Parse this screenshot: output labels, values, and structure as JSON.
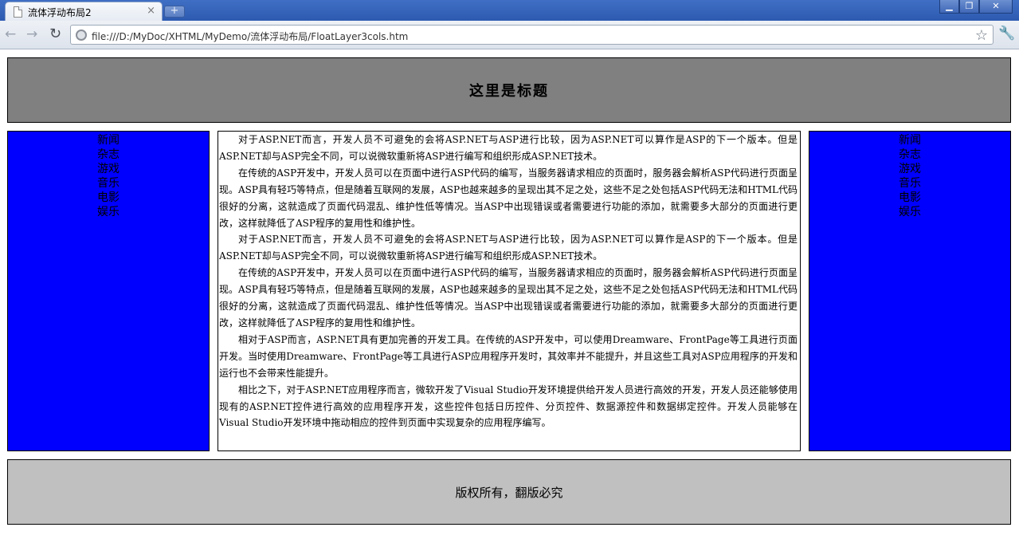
{
  "browser": {
    "tab_title": "流体浮动布局2",
    "tab_close": "×",
    "new_tab": "+",
    "url": "file:///D:/MyDoc/XHTML/MyDemo/流体浮动布局/FloatLayer3cols.htm"
  },
  "header": {
    "title": "这里是标题"
  },
  "left_nav": {
    "items": [
      "新闻",
      "杂志",
      "游戏",
      "音乐",
      "电影",
      "娱乐"
    ]
  },
  "right_nav": {
    "items": [
      "新闻",
      "杂志",
      "游戏",
      "音乐",
      "电影",
      "娱乐"
    ]
  },
  "main": {
    "paragraphs": [
      "对于ASP.NET而言，开发人员不可避免的会将ASP.NET与ASP进行比较，因为ASP.NET可以算作是ASP的下一个版本。但是ASP.NET却与ASP完全不同，可以说微软重新将ASP进行编写和组织形成ASP.NET技术。",
      "在传统的ASP开发中，开发人员可以在页面中进行ASP代码的编写，当服务器请求相应的页面时，服务器会解析ASP代码进行页面呈现。ASP具有轻巧等特点，但是随着互联网的发展，ASP也越来越多的呈现出其不足之处，这些不足之处包括ASP代码无法和HTML代码很好的分离，这就造成了页面代码混乱、维护性低等情况。当ASP中出现错误或者需要进行功能的添加，就需要多大部分的页面进行更改，这样就降低了ASP程序的复用性和维护性。",
      "对于ASP.NET而言，开发人员不可避免的会将ASP.NET与ASP进行比较，因为ASP.NET可以算作是ASP的下一个版本。但是ASP.NET却与ASP完全不同，可以说微软重新将ASP进行编写和组织形成ASP.NET技术。",
      "在传统的ASP开发中，开发人员可以在页面中进行ASP代码的编写，当服务器请求相应的页面时，服务器会解析ASP代码进行页面呈现。ASP具有轻巧等特点，但是随着互联网的发展，ASP也越来越多的呈现出其不足之处，这些不足之处包括ASP代码无法和HTML代码很好的分离，这就造成了页面代码混乱、维护性低等情况。当ASP中出现错误或者需要进行功能的添加，就需要多大部分的页面进行更改，这样就降低了ASP程序的复用性和维护性。",
      "相对于ASP而言，ASP.NET具有更加完善的开发工具。在传统的ASP开发中，可以使用Dreamware、FrontPage等工具进行页面开发。当时使用Dreamware、FrontPage等工具进行ASP应用程序开发时，其效率并不能提升，并且这些工具对ASP应用程序的开发和运行也不会带来性能提升。",
      "相比之下，对于ASP.NET应用程序而言，微软开发了Visual Studio开发环境提供给开发人员进行高效的开发，开发人员还能够使用现有的ASP.NET控件进行高效的应用程序开发，这些控件包括日历控件、分页控件、数据源控件和数据绑定控件。开发人员能够在Visual Studio开发环境中拖动相应的控件到页面中实现复杂的应用程序编写。"
    ]
  },
  "footer": {
    "text": "版权所有，翻版必究"
  },
  "icons": {
    "back": "back-arrow-icon",
    "forward": "forward-arrow-icon",
    "reload": "reload-icon",
    "page": "page-icon",
    "star": "star-icon",
    "wrench": "wrench-icon"
  },
  "colors": {
    "header_bg": "#808080",
    "side_bg": "#0000ff",
    "main_bg": "#ffffff",
    "footer_bg": "#c0c0c0",
    "titlebar": "#2d5ab0"
  }
}
